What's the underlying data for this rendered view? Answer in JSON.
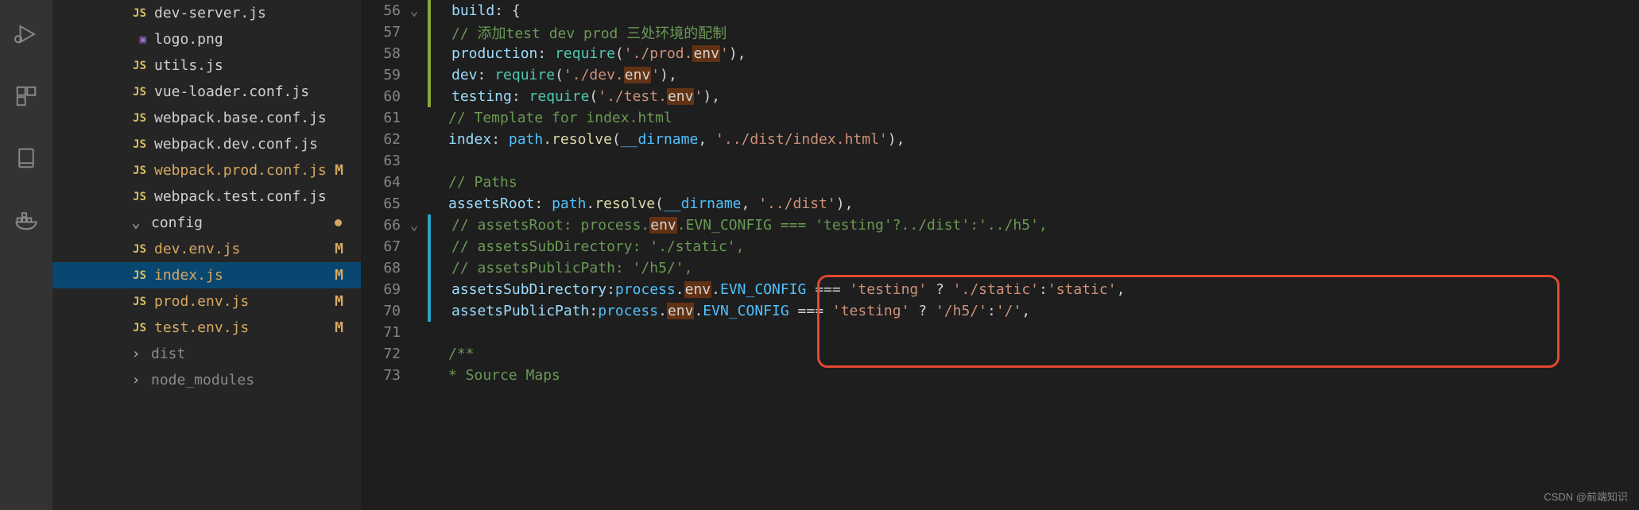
{
  "activity": {
    "icons": [
      "run-debug-icon",
      "extensions-icon",
      "notebook-icon",
      "docker-icon"
    ]
  },
  "sidebar": {
    "items": [
      {
        "icon": "JS",
        "name": "dev-server.js",
        "indent": 1,
        "type": "js",
        "dim": false
      },
      {
        "icon": "img",
        "name": "logo.png",
        "indent": 1,
        "type": "img"
      },
      {
        "icon": "JS",
        "name": "utils.js",
        "indent": 1,
        "type": "js"
      },
      {
        "icon": "JS",
        "name": "vue-loader.conf.js",
        "indent": 1,
        "type": "js"
      },
      {
        "icon": "JS",
        "name": "webpack.base.conf.js",
        "indent": 1,
        "type": "js"
      },
      {
        "icon": "JS",
        "name": "webpack.dev.conf.js",
        "indent": 1,
        "type": "js"
      },
      {
        "icon": "JS",
        "name": "webpack.prod.conf.js",
        "indent": 1,
        "type": "js",
        "status": "M",
        "mod": true
      },
      {
        "icon": "JS",
        "name": "webpack.test.conf.js",
        "indent": 1,
        "type": "js"
      },
      {
        "chevron": "down",
        "name": "config",
        "indent": 0,
        "type": "folder",
        "dot": true
      },
      {
        "icon": "JS",
        "name": "dev.env.js",
        "indent": 1,
        "type": "js",
        "status": "M",
        "mod": true
      },
      {
        "icon": "JS",
        "name": "index.js",
        "indent": 1,
        "type": "js",
        "status": "M",
        "mod": true,
        "selected": true
      },
      {
        "icon": "JS",
        "name": "prod.env.js",
        "indent": 1,
        "type": "js",
        "status": "M",
        "mod": true
      },
      {
        "icon": "JS",
        "name": "test.env.js",
        "indent": 1,
        "type": "js",
        "status": "M",
        "mod": true
      },
      {
        "chevron": "right",
        "name": "dist",
        "indent": 0,
        "type": "folder",
        "dim": true
      },
      {
        "chevron": "right",
        "name": "node_modules",
        "indent": 0,
        "type": "folder",
        "dim": true
      }
    ]
  },
  "editor": {
    "lines": [
      {
        "n": 56,
        "fold": "v",
        "mod": "mod",
        "html": "  <span class='c-prop'>build</span><span class='c-pun'>:</span> <span class='c-brace'>{</span>"
      },
      {
        "n": 57,
        "mod": "mod",
        "html": "    <span class='c-com'>// 添加test dev prod 三处环境的配制</span>"
      },
      {
        "n": 58,
        "mod": "mod",
        "html": "    <span class='c-prop'>production</span><span class='c-pun'>:</span> <span class='c-fn2'>require</span><span class='c-pun'>(</span><span class='c-str'>'./prod.<span class='c-hl'>env</span>'</span><span class='c-pun'>),</span>"
      },
      {
        "n": 59,
        "mod": "mod",
        "html": "    <span class='c-prop'>dev</span><span class='c-pun'>:</span> <span class='c-fn2'>require</span><span class='c-pun'>(</span><span class='c-str'>'./dev.<span class='c-hl'>env</span>'</span><span class='c-pun'>),</span>"
      },
      {
        "n": 60,
        "mod": "mod",
        "html": "    <span class='c-prop'>testing</span><span class='c-pun'>:</span> <span class='c-fn2'>require</span><span class='c-pun'>(</span><span class='c-str'>'./test.<span class='c-hl'>env</span>'</span><span class='c-pun'>),</span>"
      },
      {
        "n": 61,
        "html": "    <span class='c-com'>// Template for index.html</span>"
      },
      {
        "n": 62,
        "html": "    <span class='c-prop'>index</span><span class='c-pun'>:</span> <span class='c-var'>path</span><span class='c-pun'>.</span><span class='c-fn'>resolve</span><span class='c-pun'>(</span><span class='c-var'>__dirname</span><span class='c-pun'>,</span> <span class='c-str'>'../dist/index.html'</span><span class='c-pun'>),</span>"
      },
      {
        "n": 63,
        "html": ""
      },
      {
        "n": 64,
        "html": "    <span class='c-com'>// Paths</span>"
      },
      {
        "n": 65,
        "html": "    <span class='c-prop'>assetsRoot</span><span class='c-pun'>:</span> <span class='c-var'>path</span><span class='c-pun'>.</span><span class='c-fn'>resolve</span><span class='c-pun'>(</span><span class='c-var'>__dirname</span><span class='c-pun'>,</span> <span class='c-str'>'../dist'</span><span class='c-pun'>),</span>"
      },
      {
        "n": 66,
        "fold": "v",
        "mod": "add",
        "html": "    <span class='c-com'>// assetsRoot: process.<span class='c-hl'>env</span>.EVN_CONFIG === 'testing'?../dist':'../h5',</span>"
      },
      {
        "n": 67,
        "mod": "add",
        "html": "    <span class='c-com'>// assetsSubDirectory: './static',</span>"
      },
      {
        "n": 68,
        "mod": "add",
        "html": "    <span class='c-com'>// assetsPublicPath: '/h5/',</span>"
      },
      {
        "n": 69,
        "mod": "add",
        "html": "    <span class='c-prop'>assetsSubDirectory</span><span class='c-pun'>:</span><span class='c-var'>process</span><span class='c-pun'>.</span><span class='c-hl'>env</span><span class='c-pun'>.</span><span class='c-var'>EVN_CONFIG</span> <span class='c-pun'>===</span> <span class='c-str'>'testing'</span> <span class='c-pun'>?</span> <span class='c-str'>'./static'</span><span class='c-pun'>:</span><span class='c-str'>'static'</span><span class='c-pun'>,</span>"
      },
      {
        "n": 70,
        "mod": "add",
        "html": "    <span class='c-prop'>assetsPublicPath</span><span class='c-pun'>:</span><span class='c-var'>process</span><span class='c-pun'>.</span><span class='c-hl'>env</span><span class='c-pun'>.</span><span class='c-var'>EVN_CONFIG</span> <span class='c-pun'>===</span> <span class='c-str'>'testing'</span> <span class='c-pun'>?</span> <span class='c-str'>'/h5/'</span><span class='c-pun'>:</span><span class='c-str'>'/'</span><span class='c-pun'>,</span>"
      },
      {
        "n": 71,
        "html": ""
      },
      {
        "n": 72,
        "html": "    <span class='c-com'>/**</span>"
      },
      {
        "n": 73,
        "html": "<span class='c-com'>     * Source Maps</span>"
      }
    ]
  },
  "watermark": "CSDN @前端知识"
}
